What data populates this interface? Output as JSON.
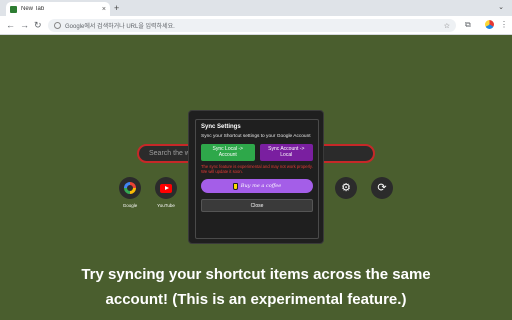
{
  "browser": {
    "tab_title": "New Tab",
    "tab_close": "×",
    "new_tab": "+",
    "tab_search": "⌄",
    "back": "←",
    "forward": "→",
    "reload": "↻",
    "omnibox_placeholder": "Google에서 검색하거나 URL을 입력하세요.",
    "bookmark_star": "☆",
    "ext_icon": "⧉",
    "menu": "⋮"
  },
  "page": {
    "search_placeholder": "Search the web",
    "shortcuts": [
      {
        "label": "Google",
        "icon": "google-icon"
      },
      {
        "label": "YouTube",
        "icon": "youtube-icon"
      }
    ],
    "settings_glyph": "⚙",
    "sync_glyph": "⟳"
  },
  "modal": {
    "title": "Sync Settings",
    "description": "Sync your Shortcut settings to your Google Account",
    "sync_local_label": "Sync Local -> Account",
    "sync_account_label": "Sync Account -> Local",
    "warning": "The sync feature is experimental and may not work properly. We will update it soon.",
    "coffee_label": "Buy me a coffee",
    "close_label": "Close",
    "colors": {
      "sync_local": "#2ea84a",
      "sync_account": "#7a1fa0",
      "coffee": "#a45ee8",
      "warning": "#e53935"
    }
  },
  "caption": {
    "line1": "Try syncing your shortcut items across the same",
    "line2": "account! (This is an experimental feature.)"
  },
  "colors": {
    "background": "#4a5e2e",
    "search_border": "#c62828"
  }
}
